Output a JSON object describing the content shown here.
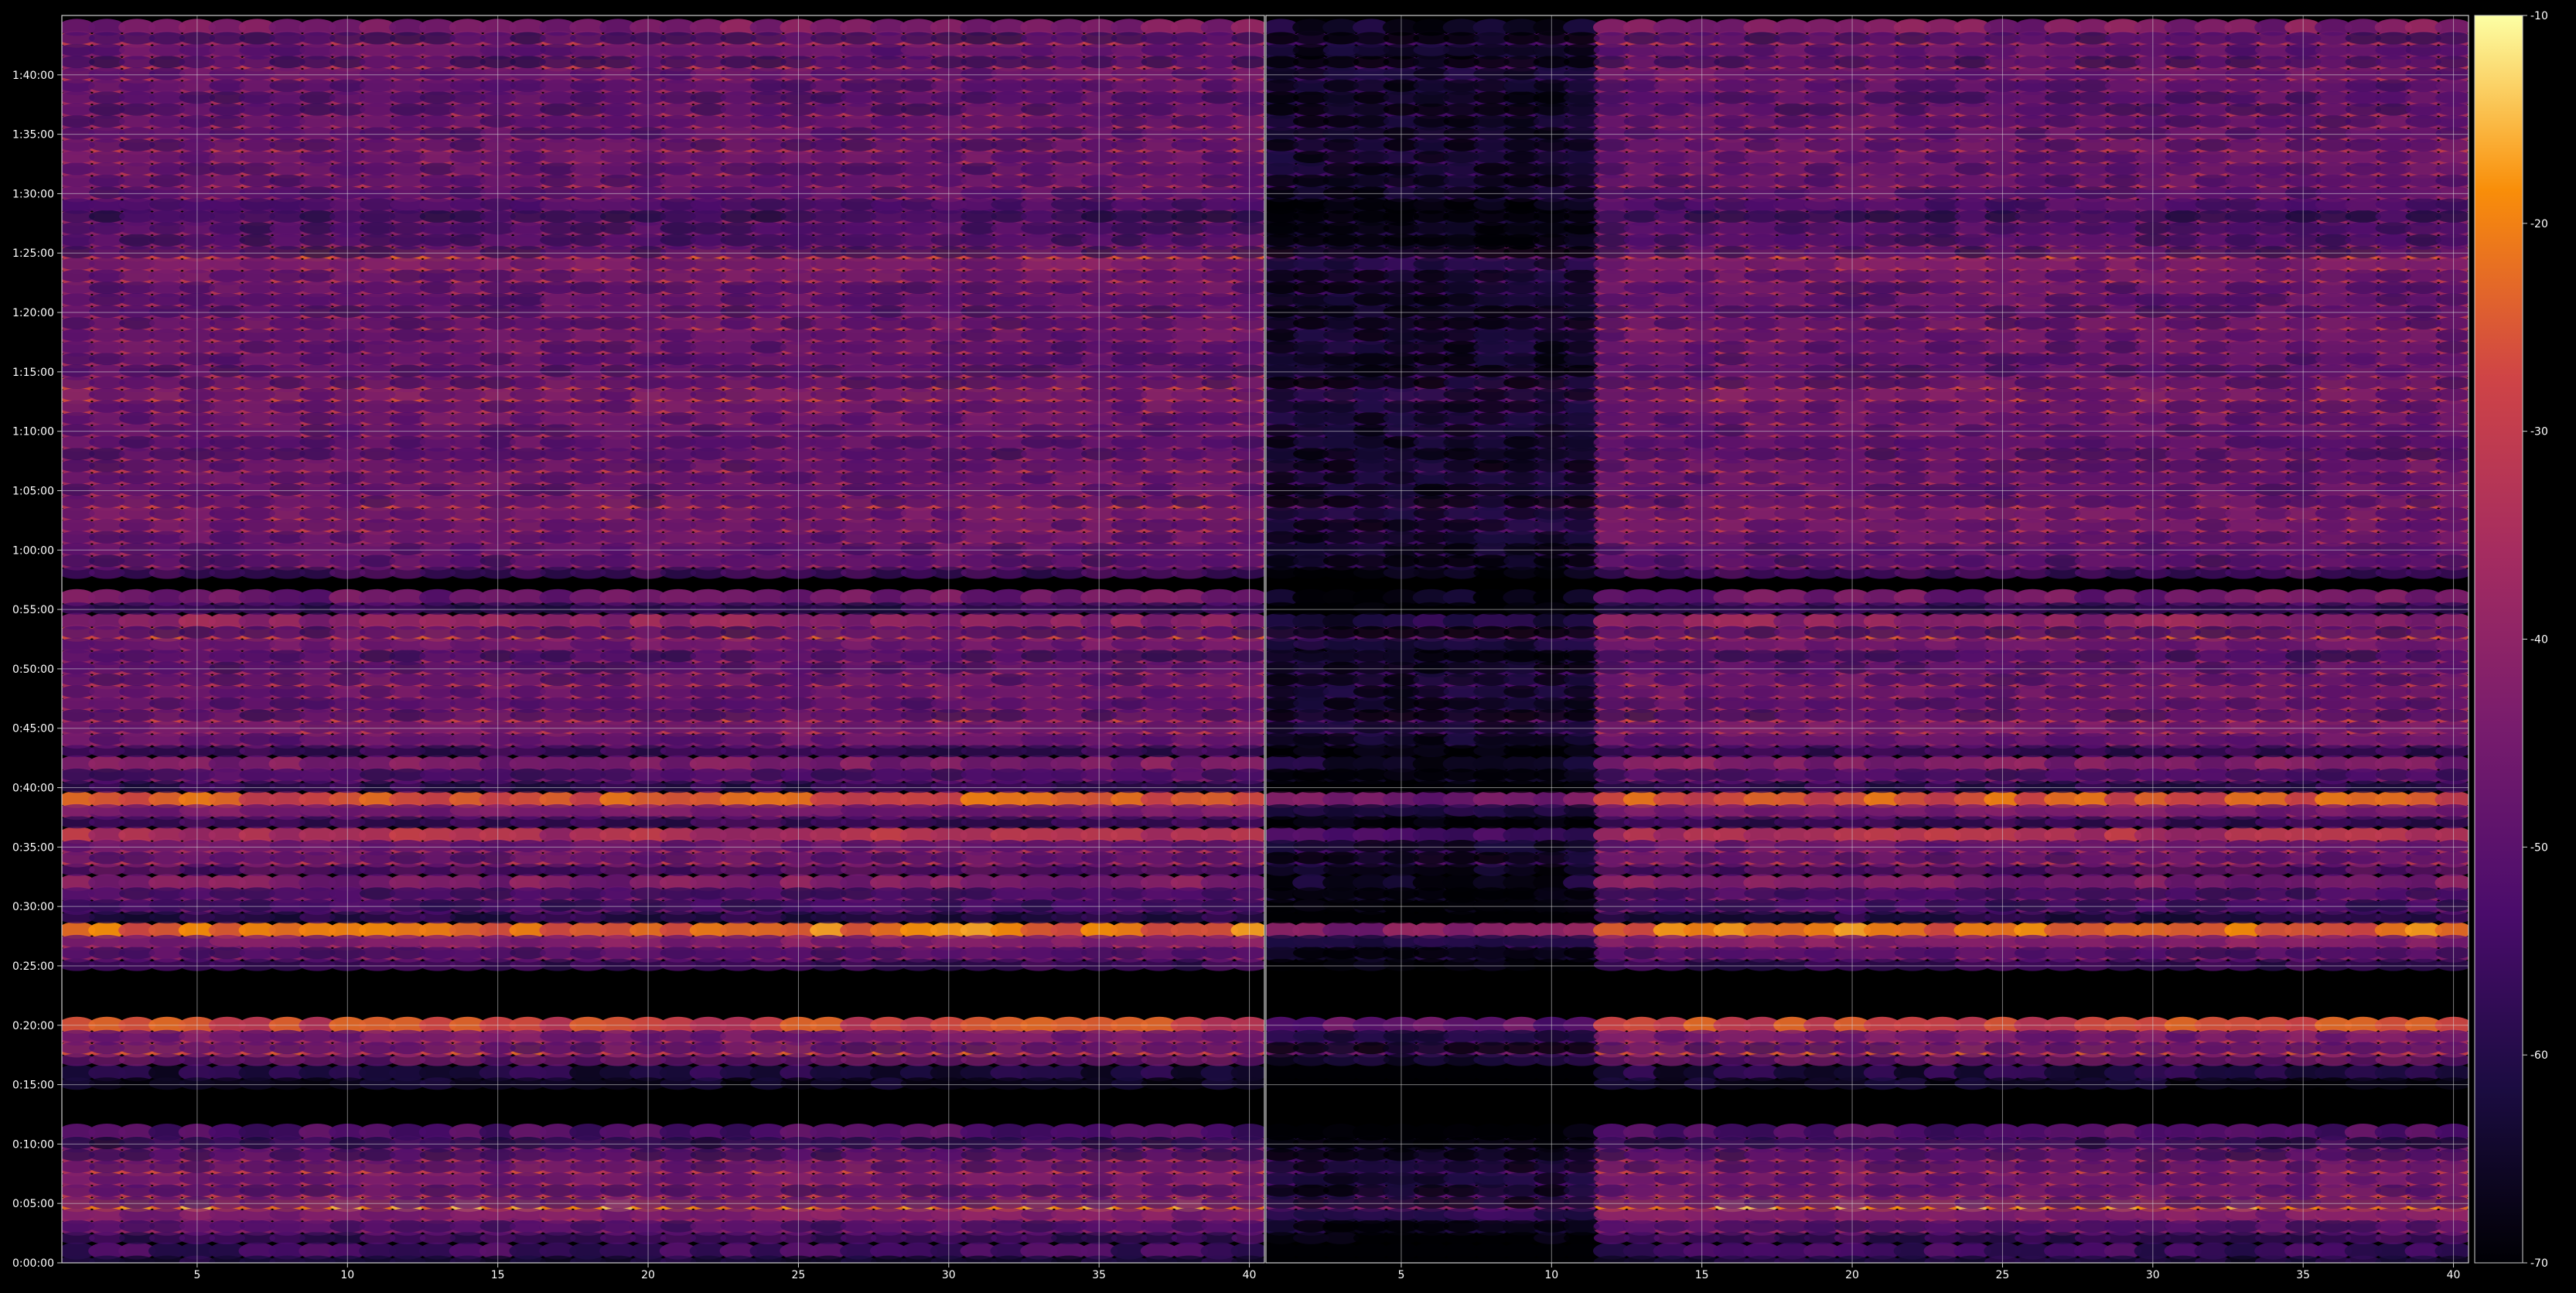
{
  "chart_data": {
    "type": "heatmap",
    "title": "",
    "xlabel": "",
    "ylabel": "",
    "grid": true,
    "panels": [
      {
        "name": "",
        "x_range": [
          1,
          40
        ],
        "x_ticks": [
          5,
          10,
          15,
          20,
          25,
          30,
          35,
          40
        ],
        "faded_band_x": [
          1,
          11
        ]
      },
      {
        "name": "",
        "x_range": [
          1,
          40
        ],
        "x_ticks": [
          5,
          10,
          15,
          20,
          25,
          30,
          35,
          40
        ],
        "faded_band_x": [
          0,
          0
        ]
      }
    ],
    "y_range_seconds": [
      0,
      6300
    ],
    "y_ticks": [
      "0:00:00",
      "0:05:00",
      "0:10:00",
      "0:15:00",
      "0:20:00",
      "0:25:00",
      "0:30:00",
      "0:35:00",
      "0:40:00",
      "0:45:00",
      "0:50:00",
      "0:55:00",
      "1:00:00",
      "1:05:00",
      "1:10:00",
      "1:15:00",
      "1:20:00",
      "1:25:00",
      "1:30:00",
      "1:35:00",
      "1:40:00"
    ],
    "row_profile": {
      "description": "approximate intensity (dB) per time row, 0–1 scale of colormap by minute",
      "rows_minutes": [
        1,
        3,
        4,
        5,
        6,
        7,
        8,
        9,
        10,
        11,
        16,
        18,
        19,
        20,
        26,
        27,
        28,
        30,
        31,
        32,
        34,
        35,
        36,
        38,
        39,
        41,
        42,
        44,
        45,
        46,
        47,
        48,
        49,
        50,
        51,
        52,
        53,
        54,
        56,
        59,
        60,
        61,
        62,
        63,
        64,
        65,
        66,
        67,
        68,
        69,
        70,
        71,
        72,
        73,
        74,
        75,
        76,
        77,
        78,
        79,
        80,
        81,
        82,
        83,
        84,
        85,
        86,
        87,
        88,
        89,
        90,
        91,
        92,
        93,
        94,
        95,
        96,
        97,
        98,
        99,
        100,
        101,
        102,
        103,
        104
      ],
      "levels": [
        0.25,
        0.45,
        0.5,
        0.8,
        0.6,
        0.55,
        0.65,
        0.55,
        0.45,
        0.3,
        0.15,
        0.7,
        0.55,
        0.7,
        0.45,
        0.5,
        0.8,
        0.35,
        0.4,
        0.45,
        0.6,
        0.55,
        0.6,
        0.45,
        0.75,
        0.4,
        0.45,
        0.45,
        0.6,
        0.65,
        0.5,
        0.55,
        0.6,
        0.55,
        0.5,
        0.45,
        0.7,
        0.5,
        0.4,
        0.5,
        0.5,
        0.55,
        0.6,
        0.6,
        0.65,
        0.55,
        0.55,
        0.6,
        0.55,
        0.5,
        0.55,
        0.55,
        0.6,
        0.6,
        0.65,
        0.55,
        0.5,
        0.55,
        0.55,
        0.6,
        0.55,
        0.5,
        0.55,
        0.55,
        0.6,
        0.7,
        0.45,
        0.45,
        0.45,
        0.35,
        0.5,
        0.55,
        0.55,
        0.55,
        0.6,
        0.55,
        0.55,
        0.55,
        0.5,
        0.5,
        0.55,
        0.6,
        0.45,
        0.6,
        0.45
      ]
    },
    "colorbar": {
      "colormap": "inferno",
      "min": -70,
      "max": -10,
      "ticks": [
        -70,
        -60,
        -50,
        -40,
        -30,
        -20,
        -10
      ]
    }
  },
  "colors": {
    "background": "#000000",
    "axis": "#cfcfcf",
    "grid": "#d8d8d8",
    "text": "#ffffff"
  }
}
